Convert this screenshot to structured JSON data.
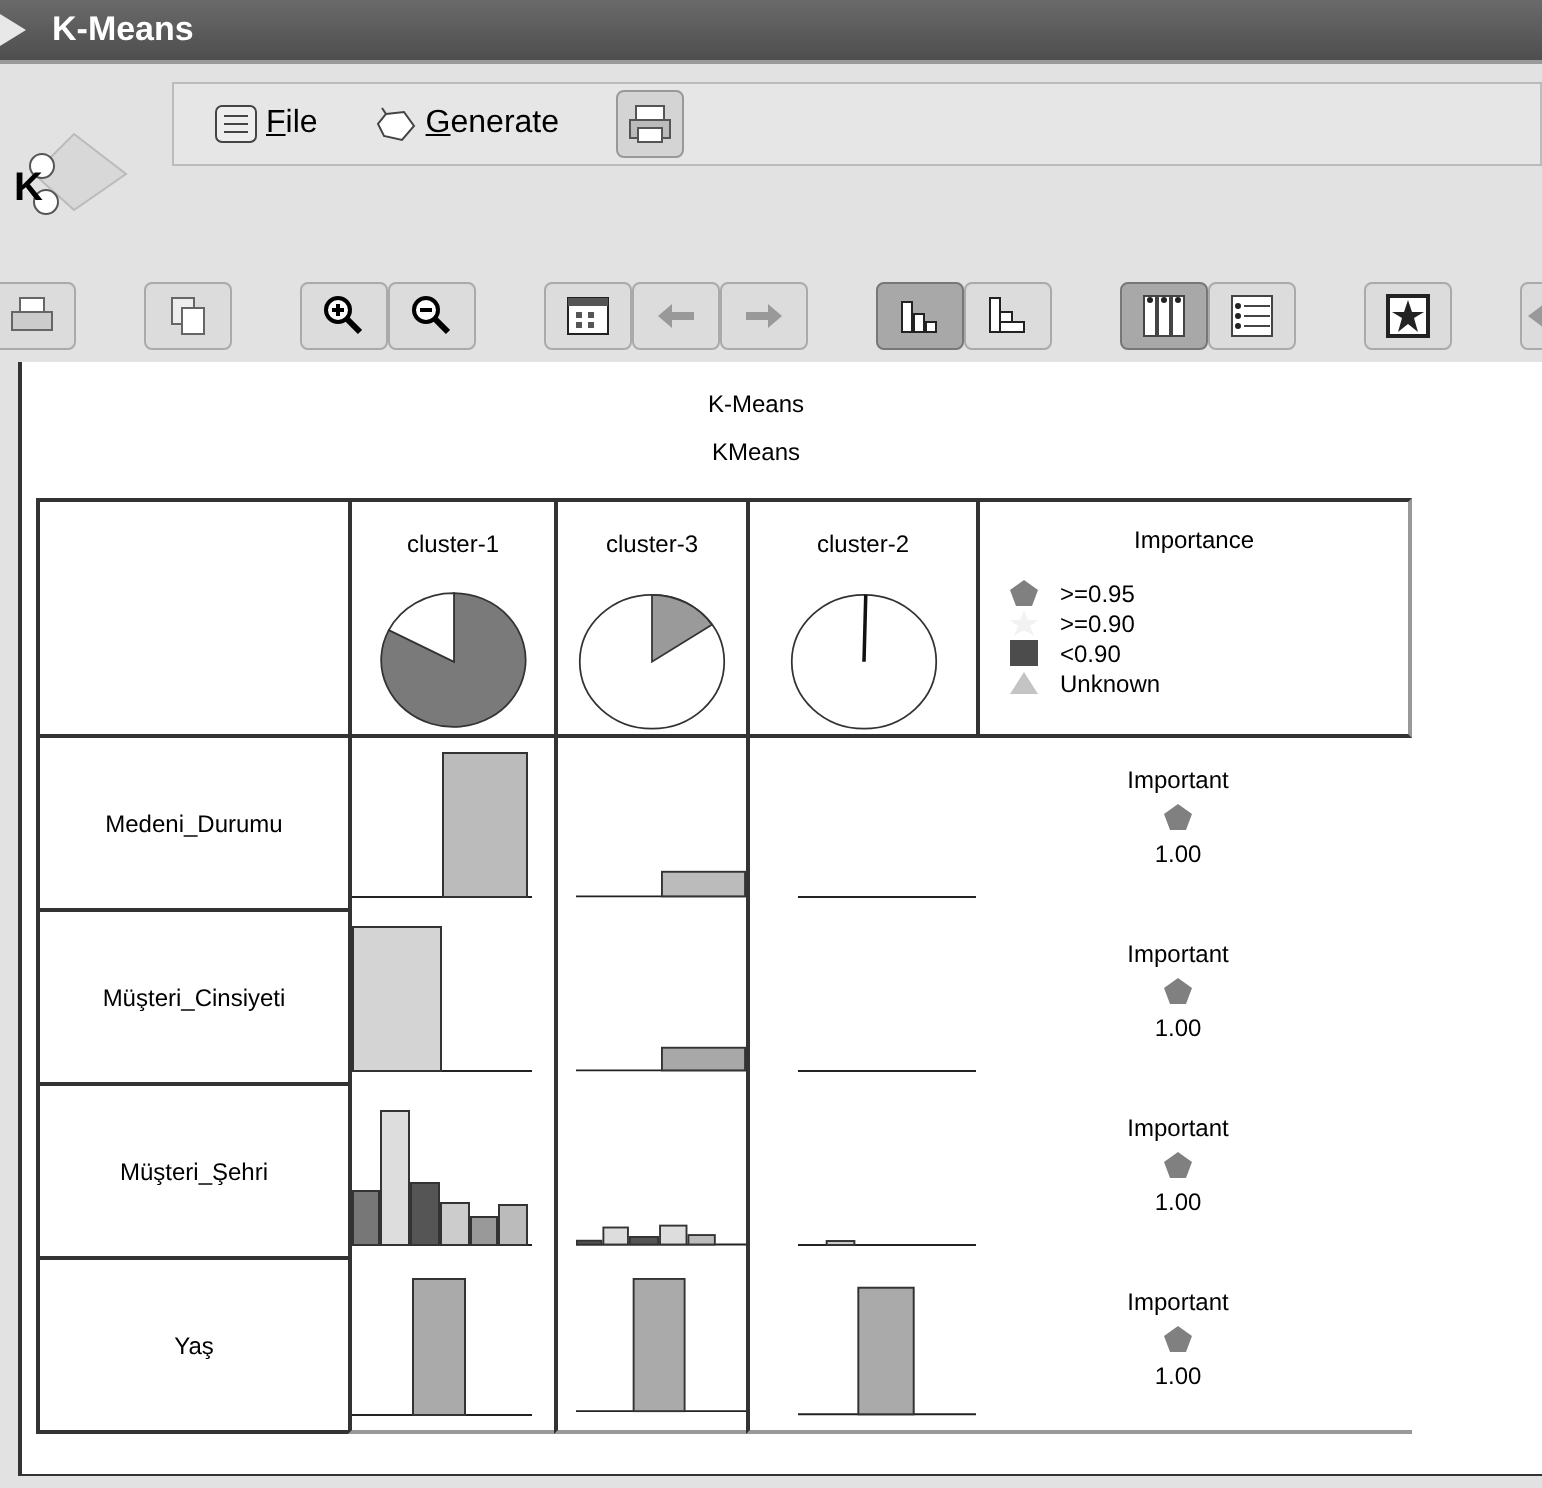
{
  "window": {
    "title": "K-Means"
  },
  "menu": [
    {
      "label": "File",
      "kind": "file"
    },
    {
      "label": "Generate",
      "kind": "generate"
    }
  ],
  "logo_letter": "K",
  "toolbar": [
    {
      "kind": "print",
      "pressed": false
    },
    {
      "kind": "copy",
      "pressed": false
    },
    {
      "kind": "zoom-in",
      "pressed": false
    },
    {
      "kind": "zoom-out",
      "pressed": false
    },
    {
      "kind": "table",
      "pressed": false
    },
    {
      "kind": "back",
      "pressed": false
    },
    {
      "kind": "forward",
      "pressed": false
    },
    {
      "kind": "bars-up",
      "pressed": true
    },
    {
      "kind": "bars-side",
      "pressed": false
    },
    {
      "kind": "columns",
      "pressed": true
    },
    {
      "kind": "list",
      "pressed": false
    },
    {
      "kind": "star",
      "pressed": false
    },
    {
      "kind": "cut",
      "pressed": false
    }
  ],
  "titles": [
    "K-Means",
    "KMeans"
  ],
  "clusters": [
    {
      "label": "cluster-1"
    },
    {
      "label": "cluster-3"
    },
    {
      "label": "cluster-2"
    }
  ],
  "legend": {
    "title": "Importance",
    "items": [
      {
        "kind": "pentagon",
        "label": ">=0.95"
      },
      {
        "kind": "star",
        "label": ">=0.90"
      },
      {
        "kind": "square",
        "label": "<0.90"
      },
      {
        "kind": "triangle",
        "label": "Unknown"
      }
    ]
  },
  "rows": [
    {
      "field": "Medeni_Durumu",
      "importance": "Important",
      "value": "1.00"
    },
    {
      "field": "Müşteri_Cinsiyeti",
      "importance": "Important",
      "value": "1.00"
    },
    {
      "field": "Müşteri_Şehri",
      "importance": "Important",
      "value": "1.00"
    },
    {
      "field": "Yaş",
      "importance": "Important",
      "value": "1.00"
    }
  ]
}
